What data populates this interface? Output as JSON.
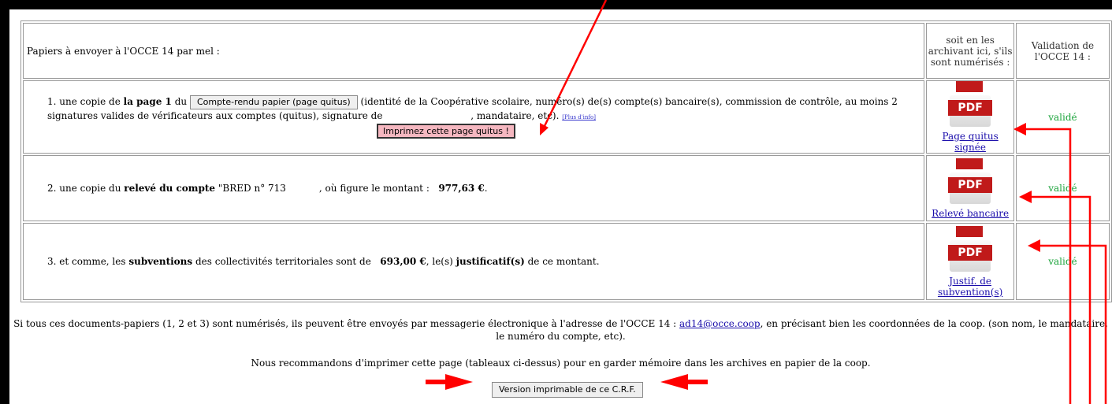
{
  "header": {
    "intro": "Papiers à envoyer à l'OCCE 14   par mel :",
    "archive_col": "soit en les archivant ici, s'ils sont numérisés :",
    "validation_col": "Validation de l'OCCE 14 :"
  },
  "rows": [
    {
      "num": "1. une copie de",
      "bold1": "la page 1",
      "du": "du",
      "button": "Compte-rendu papier (page quitus)",
      "text": "(identité de la Coopérative scolaire, numéro(s) de(s) compte(s) bancaire(s), commission de contrôle, au moins 2 signatures valides de vérificateurs aux comptes (quitus), signature de",
      "text2": ", mandataire, etc).",
      "info": "[Plus d'info]",
      "print_button": "Imprimez cette page quitus !",
      "doc_label": "Page quitus signée",
      "status": "validé"
    },
    {
      "num": "2. une copie du",
      "bold1": "relevé du compte",
      "text": "\"BRED n° 713",
      "text2": ", où figure le montant :",
      "amount": "977,63 €",
      "doc_label": "Relevé bancaire",
      "status": "validé"
    },
    {
      "num": "3. et comme, les",
      "bold1": "subventions",
      "text": "des collectivités territoriales sont de",
      "amount": "693,00 €",
      "text2": ", le(s)",
      "bold2": "justificatif(s)",
      "text3": "de ce montant.",
      "doc_label": "Justif. de subvention(s)",
      "status": "validé"
    }
  ],
  "pdf_icon_text": "PDF",
  "footer": {
    "note1_pre": "Si tous ces documents-papiers (1, 2 et 3) sont numérisés, ils peuvent être envoyés par messagerie électronique à l'adresse de l'OCCE 14 :",
    "email": "ad14@occe.coop",
    "note1_post": ", en précisant bien les coordonnées de la coop. (son nom, le mandataire, le numéro du compte, etc).",
    "note2": "Nous recommandons d'imprimer cette page (tableaux ci-dessus) pour en garder mémoire dans les archives en papier de la coop.",
    "print_version_button": "Version imprimable de ce C.R.F."
  },
  "annotation_color": "#ff0000"
}
